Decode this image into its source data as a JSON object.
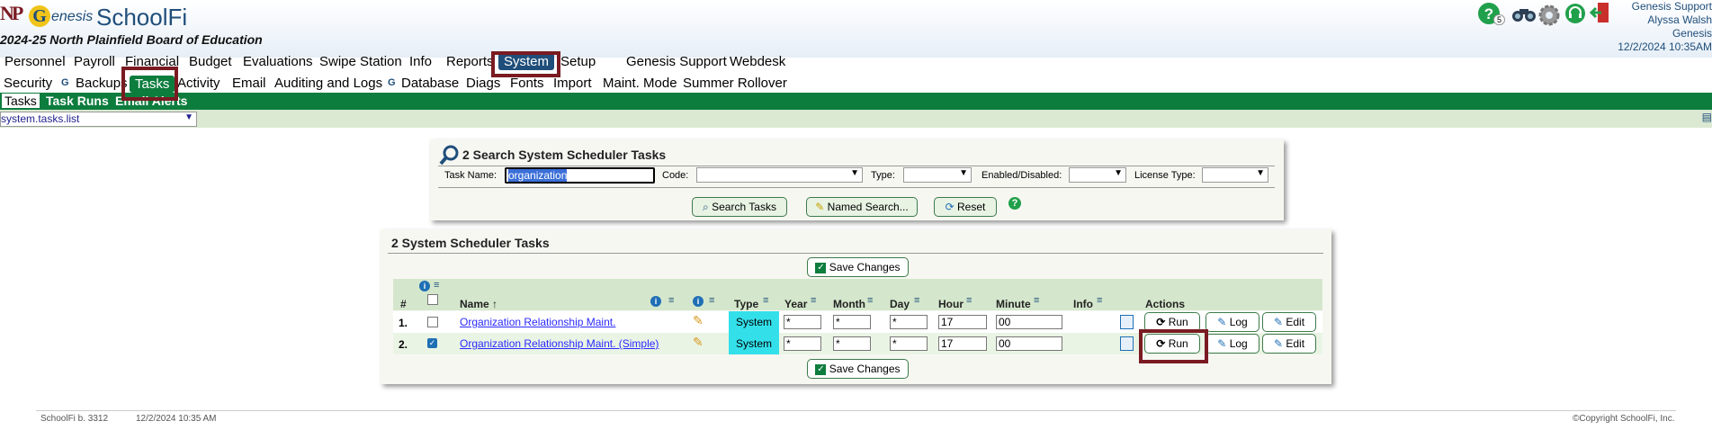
{
  "header": {
    "logo_initials": "NP",
    "logo_g": "G",
    "brand": "enesis",
    "app_name": "SchoolFi",
    "school_year": "2024-25",
    "school_name": "North Plainfield Board of Education",
    "help_badge": "5",
    "user_lines": [
      "Genesis Support",
      "Alyssa Walsh",
      "Genesis",
      "12/2/2024 10:35AM"
    ]
  },
  "menu_primary": [
    "Personnel",
    "Payroll",
    "Financial",
    "Budget",
    "Evaluations",
    "Swipe Station",
    "Info",
    "Reports",
    "System",
    "Setup",
    "Genesis Support",
    "Webdesk"
  ],
  "menu_secondary": [
    "Security",
    "Backups",
    "Tasks",
    "Activity",
    "Email",
    "Auditing and Logs",
    "Database",
    "Diags",
    "Fonts",
    "Import",
    "Maint. Mode",
    "Summer Rollover"
  ],
  "subtabs": [
    "Tasks",
    "Task Runs",
    "Email Alerts"
  ],
  "screen_select": "system.tasks.list",
  "search": {
    "title": "2 Search System Scheduler Tasks",
    "task_name_label": "Task Name:",
    "task_name_value": "organization",
    "code_label": "Code:",
    "type_label": "Type:",
    "enabled_label": "Enabled/Disabled:",
    "license_label": "License Type:",
    "search_btn": "Search Tasks",
    "named_btn": "Named Search...",
    "reset_btn": "Reset",
    "help": "?"
  },
  "results": {
    "title": "2 System Scheduler Tasks",
    "save_btn": "Save Changes",
    "columns": {
      "num": "#",
      "name": "Name ↑",
      "type": "Type",
      "year": "Year",
      "month": "Month",
      "day": "Day",
      "hour": "Hour",
      "minute": "Minute",
      "info": "Info",
      "actions": "Actions"
    },
    "rows": [
      {
        "num": "1.",
        "checked": false,
        "name": "Organization Relationship Maint.",
        "type": "System",
        "year": "*",
        "month": "*",
        "day": "*",
        "hour": "17",
        "minute": "00"
      },
      {
        "num": "2.",
        "checked": true,
        "name": "Organization Relationship Maint. (Simple)",
        "type": "System",
        "year": "*",
        "month": "*",
        "day": "*",
        "hour": "17",
        "minute": "00"
      }
    ],
    "run_btn": "Run",
    "log_btn": "Log",
    "edit_btn": "Edit"
  },
  "footer": {
    "build": "SchoolFi b. 3312",
    "timestamp": "12/2/2024 10:35 AM",
    "copyright": "©Copyright SchoolFi, Inc."
  },
  "colors": {
    "accent_green": "#0d7d3e",
    "highlight_red": "#7a1b22",
    "brand_blue": "#1f4e7a",
    "type_cell": "#33e0ea"
  }
}
